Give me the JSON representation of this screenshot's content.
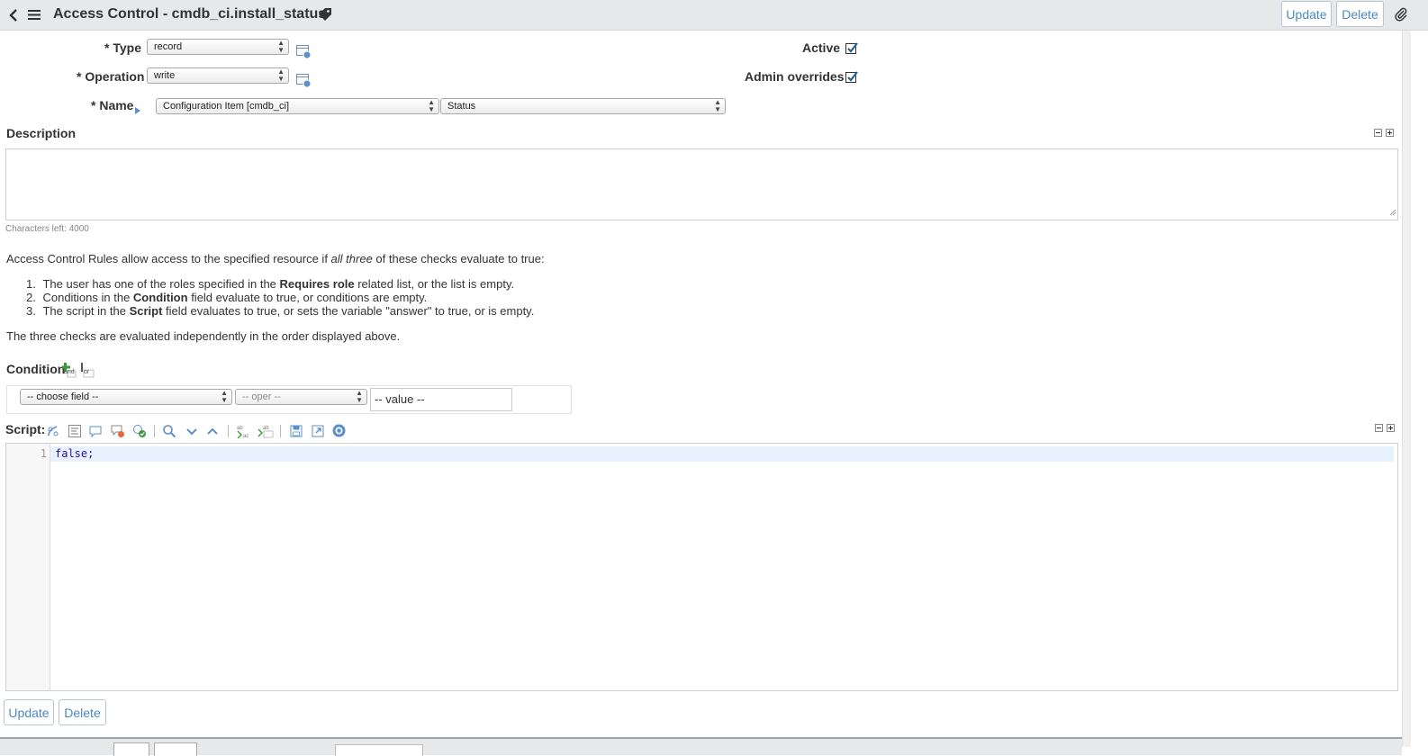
{
  "header": {
    "title": "Access Control - cmdb_ci.install_status",
    "update_label": "Update",
    "delete_label": "Delete"
  },
  "form": {
    "type": {
      "label": "* Type",
      "value": "record"
    },
    "operation": {
      "label": "* Operation",
      "value": "write"
    },
    "name": {
      "label": "* Name",
      "table": "Configuration Item [cmdb_ci]",
      "field": "Status"
    },
    "active": {
      "label": "Active",
      "checked": true
    },
    "admin_overrides": {
      "label": "Admin overrides",
      "checked": true
    },
    "description": {
      "label": "Description",
      "value": "",
      "chars_left": "Characters left: 4000"
    }
  },
  "info": {
    "intro_a": "Access Control Rules allow access to the specified resource if ",
    "intro_em": "all three",
    "intro_b": " of these checks evaluate to true:",
    "items": [
      {
        "num": "1.",
        "a": "The user has one of the roles specified in the ",
        "b": "Requires role",
        "c": " related list, or the list is empty."
      },
      {
        "num": "2.",
        "a": "Conditions in the ",
        "b": "Condition",
        "c": " field evaluate to true, or conditions are empty."
      },
      {
        "num": "3.",
        "a": "The script in the ",
        "b": "Script",
        "c": " field evaluates to true, or sets the variable \"answer\" to true, or is empty."
      }
    ],
    "footer": "The three checks are evaluated independently in the order displayed above."
  },
  "condition": {
    "label": "Condition",
    "and_label": "and",
    "or_label": "or",
    "field_placeholder": "-- choose field --",
    "oper_placeholder": "-- oper --",
    "value_placeholder": "-- value --"
  },
  "script": {
    "label": "Script:",
    "lines": [
      {
        "num": "1",
        "code": "false;"
      }
    ]
  },
  "footer_buttons": {
    "update_label": "Update",
    "delete_label": "Delete"
  },
  "colors": {
    "accent": "#4a88c5",
    "header_bg": "#e6e8ea",
    "active_line": "#e8f2ff"
  }
}
